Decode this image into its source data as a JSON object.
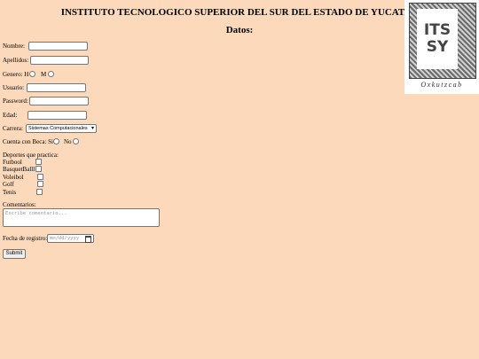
{
  "header": {
    "title": "INSTITUTO TECNOLOGICO SUPERIOR DEL SUR DEL ESTADO DE YUCATAN",
    "subtitle": "Datos:"
  },
  "logo": {
    "line1": "ITS",
    "line2": "SY",
    "caption": "Oxkutzcab"
  },
  "form": {
    "nombre_label": "Nombre:",
    "apellidos_label": "Apellidos:",
    "genero_label": "Genero: H",
    "genero_m": "M",
    "usuario_label": "Usuario:",
    "password_label": "Password:",
    "edad_label": "Edad:",
    "carrera_label": "Carrera:",
    "carrera_selected": "Sistemas Computacionales",
    "beca_label": "Cuenta con Beca: Si",
    "beca_no": "No",
    "deportes_label": "Deportes que practica:",
    "deportes": [
      "Futbool",
      "BasquetBalll",
      "Voleibol",
      "Golf",
      "Tenis"
    ],
    "comentarios_label": "Comentarios:",
    "comentarios_placeholder": "Escribe comentario...",
    "fecha_label": "Fecha de registro:",
    "fecha_placeholder": "mm/dd/yyyy",
    "submit_label": "Submit"
  }
}
